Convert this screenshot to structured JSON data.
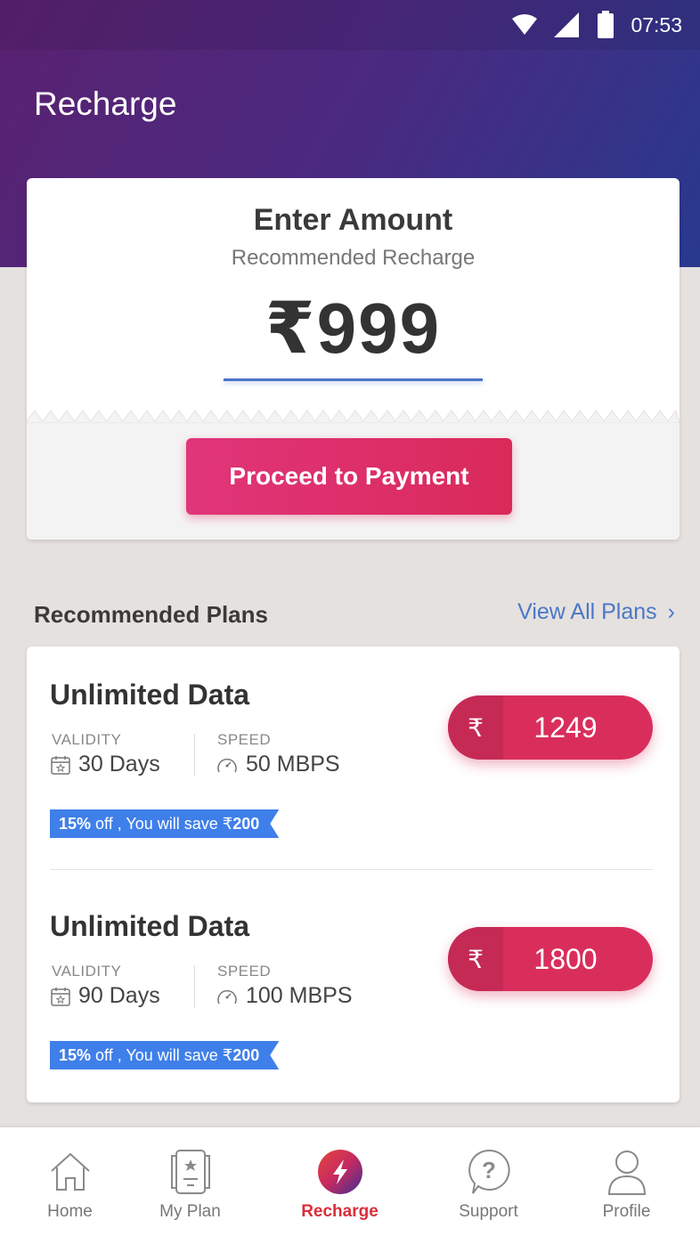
{
  "status": {
    "time": "07:53"
  },
  "header": {
    "title": "Recharge"
  },
  "amount_card": {
    "title": "Enter Amount",
    "subtitle": "Recommended Recharge",
    "amount": "₹999",
    "button": "Proceed to Payment"
  },
  "plans_section": {
    "title": "Recommended Plans",
    "view_all": "View All Plans",
    "view_all_chevron": "›"
  },
  "plans": [
    {
      "name": "Unlimited Data",
      "validity_label": "VALIDITY",
      "validity": "30 Days",
      "speed_label": "SPEED",
      "speed": "50 MBPS",
      "currency": "₹",
      "price": "1249",
      "offer_percent": "15%",
      "offer_text": "off , You will save ₹",
      "offer_save": "200"
    },
    {
      "name": "Unlimited Data",
      "validity_label": "VALIDITY",
      "validity": "90 Days",
      "speed_label": "SPEED",
      "speed": "100 MBPS",
      "currency": "₹",
      "price": "1800",
      "offer_percent": "15%",
      "offer_text": "off , You will save ₹",
      "offer_save": "200"
    }
  ],
  "nav": [
    {
      "label": "Home",
      "icon": "home-icon"
    },
    {
      "label": "My Plan",
      "icon": "plan-card-icon"
    },
    {
      "label": "Recharge",
      "icon": "lightning-icon",
      "active": true
    },
    {
      "label": "Support",
      "icon": "help-bubble-icon"
    },
    {
      "label": "Profile",
      "icon": "person-icon"
    }
  ],
  "colors": {
    "accent": "#d92e5c",
    "link": "#4a78c6",
    "offer": "#3f7fea",
    "header": "#4a2a80"
  }
}
